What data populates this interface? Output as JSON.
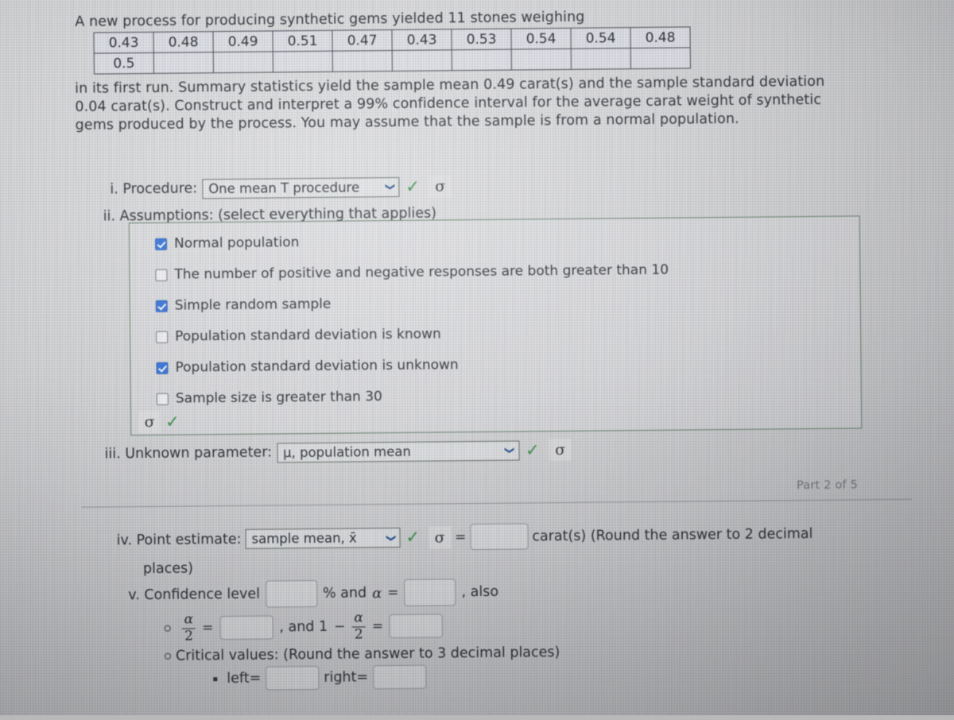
{
  "problem": {
    "intro": "A new process for producing synthetic gems yielded 11 stones weighing",
    "data_row_1": [
      "0.43",
      "0.48",
      "0.49",
      "0.51",
      "0.47",
      "0.43",
      "0.53",
      "0.54",
      "0.54",
      "0.48"
    ],
    "data_row_2": [
      "0.5",
      "",
      "",
      "",
      "",
      "",
      "",
      "",
      "",
      ""
    ],
    "body": "in its first run. Summary statistics yield the sample mean 0.49 carat(s) and the sample standard deviation 0.04 carat(s). Construct and interpret a 99% confidence interval for the average carat weight of synthetic gems produced by the process. You may assume that the sample is from a normal population."
  },
  "step_i": {
    "label": "i. Procedure:",
    "selected": "One mean T procedure",
    "caret": "❯",
    "check": "✓",
    "sigma": "σ"
  },
  "step_ii": {
    "label": "ii. Assumptions: (select everything that applies)",
    "options": [
      {
        "label": "Normal population",
        "checked": true
      },
      {
        "label": "The number of positive and negative responses are both greater than 10",
        "checked": false
      },
      {
        "label": "Simple random sample",
        "checked": true
      },
      {
        "label": "Population standard deviation is known",
        "checked": false
      },
      {
        "label": "Population standard deviation is unknown",
        "checked": true
      },
      {
        "label": "Sample size is greater than 30",
        "checked": false
      }
    ],
    "sigma": "σ",
    "check": "✓"
  },
  "step_iii": {
    "label": "iii. Unknown parameter:",
    "selected": "μ, population mean",
    "caret": "❯",
    "check": "✓",
    "sigma": "σ"
  },
  "part_label": "Part 2 of 5",
  "step_iv": {
    "label": "iv. Point estimate:",
    "selected": "sample mean, x̄",
    "caret": "❯",
    "check": "✓",
    "sigma": "σ",
    "equals": "=",
    "value": "",
    "suffix": "carat(s) (Round the answer to 2 decimal",
    "suffix_cont": "places)"
  },
  "step_v": {
    "label": "v. Confidence level",
    "level_value": "",
    "percent_text": "% and",
    "alpha": "α",
    "equals": "=",
    "alpha_value": "",
    "also_text": ", also",
    "alpha_num": "α",
    "alpha_den": "2",
    "half_value": "",
    "and_one_text": ", and 1",
    "minus": "−",
    "one_minus_value": "",
    "critical_label": "Critical values: (Round the answer to 3 decimal places)",
    "left_label": "left=",
    "left_value": "",
    "right_label": "right=",
    "right_value": ""
  },
  "colors": {
    "background": "#c4c5c7",
    "text": "#262a30",
    "checkbox_checked": "#2f6fd8",
    "check_mark": "#2f8a3e",
    "select_border": "#5d6a60",
    "assumption_border": "#5f7a63",
    "part_label": "#6d7076"
  }
}
